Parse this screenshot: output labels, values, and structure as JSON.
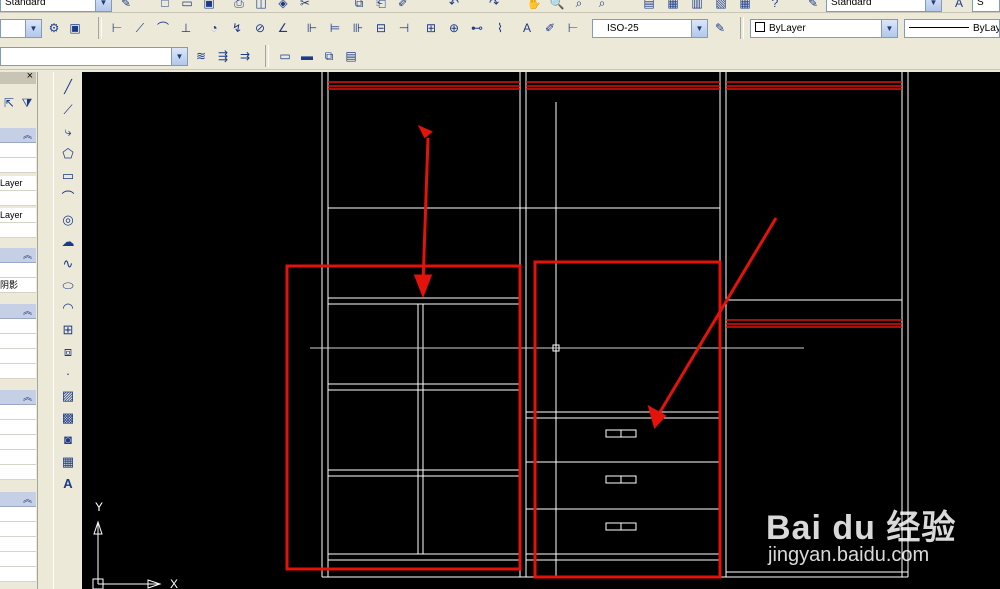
{
  "toolbar_top": {
    "text_style_combo": "Standard",
    "table_style_combo": "Standard"
  },
  "toolbar_dim": {
    "dim_style_combo": "ISO-25",
    "layer_color_combo": "ByLayer",
    "linetype_combo": "ByLay"
  },
  "palette": {
    "rows": [
      "Layer",
      "Layer",
      "阴影"
    ]
  },
  "drawing": {
    "ucs_y_label": "Y",
    "ucs_x_label": "X"
  },
  "watermark": {
    "brand": "Bai du 经验",
    "url": "jingyan.baidu.com"
  },
  "colors": {
    "canvas": "#000000",
    "geometry": "#ffffff",
    "highlight": "#e3120b",
    "toolbar": "#ece9d8"
  }
}
